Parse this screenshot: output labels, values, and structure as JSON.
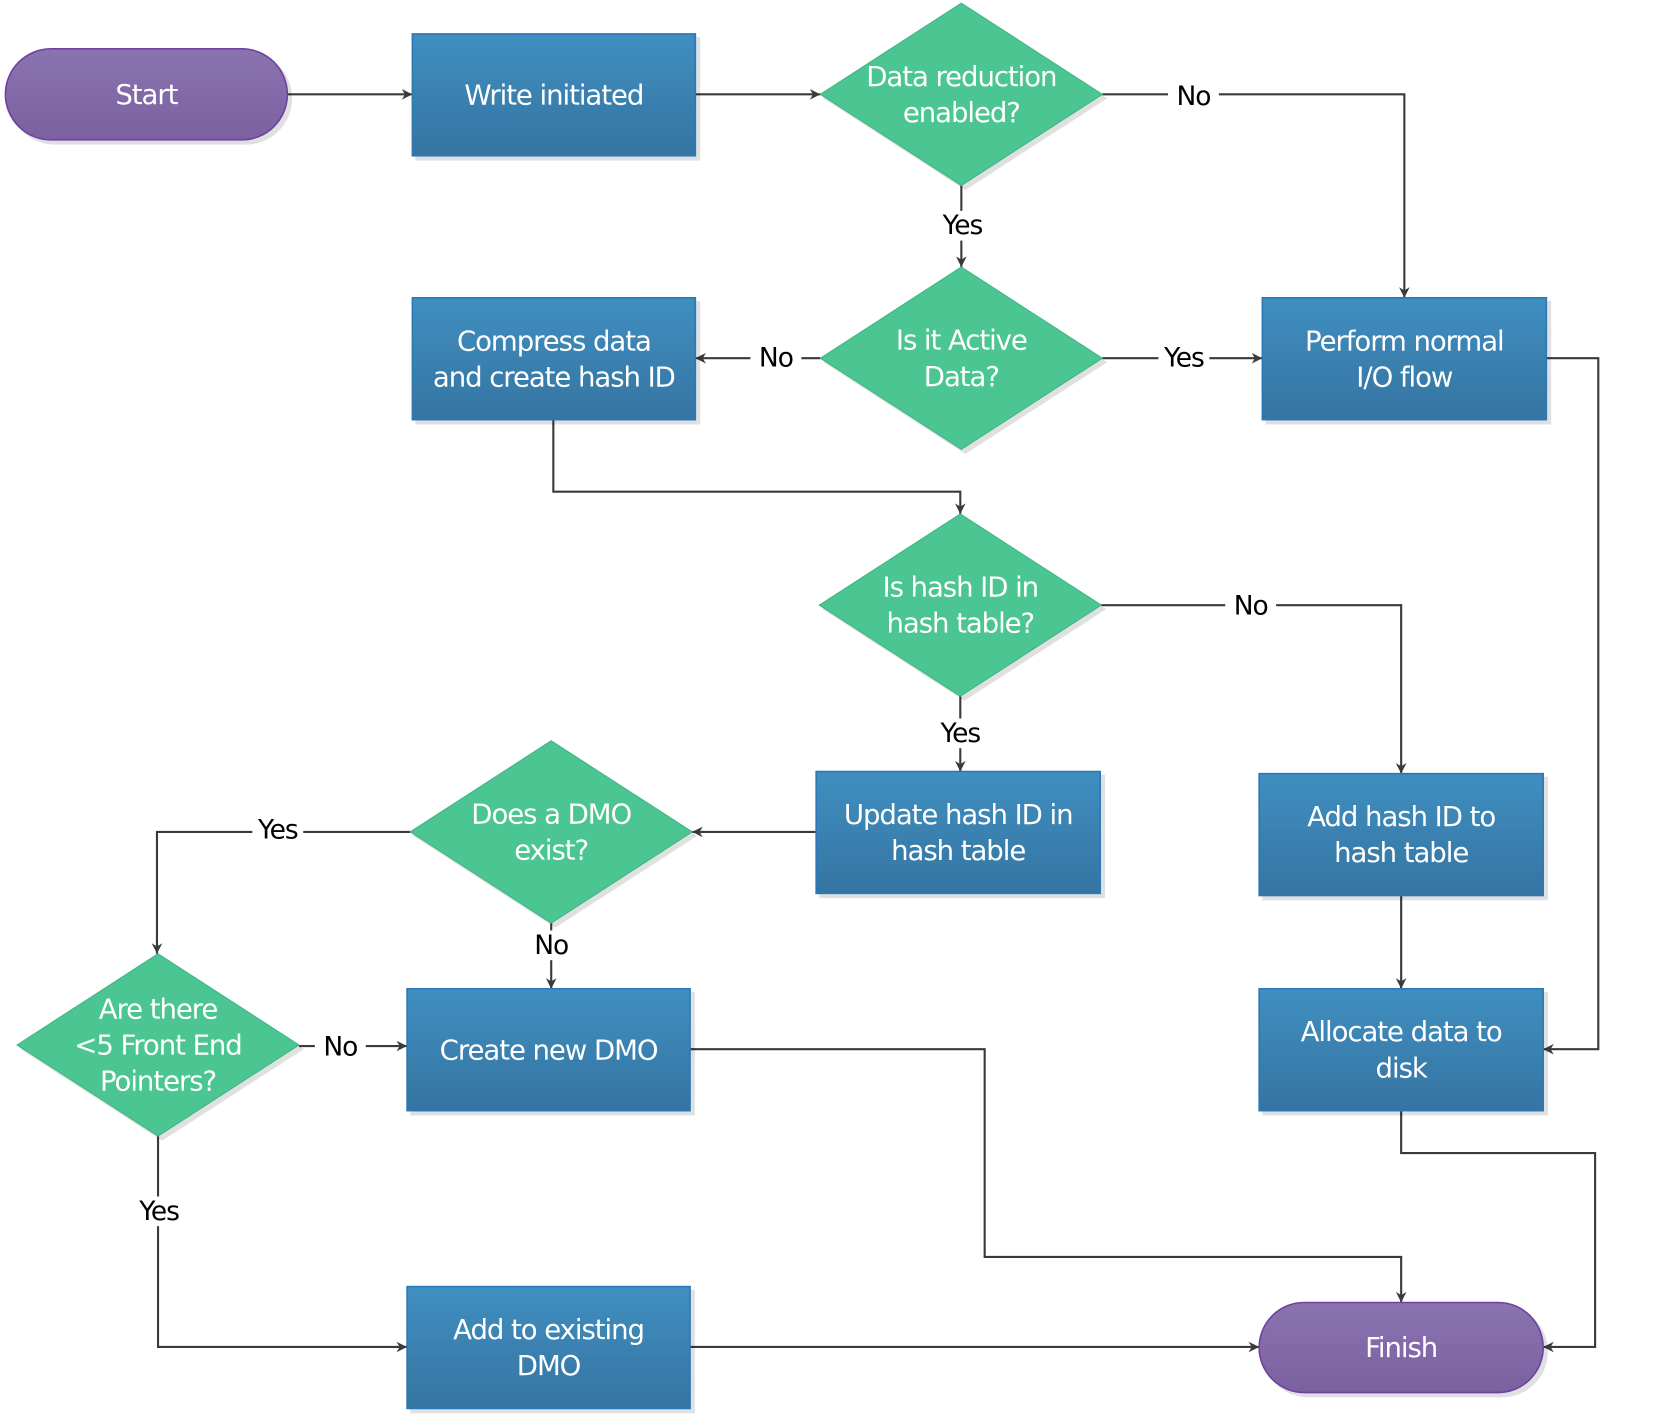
{
  "colors": {
    "process_top": "#3f8fc0",
    "process_bottom": "#3574a2",
    "decision": "#4cc592",
    "terminal_top": "#8a74b0",
    "terminal_bottom": "#7a61a0",
    "connector": "#3a3a3a"
  },
  "nodes": {
    "start": {
      "type": "terminal",
      "lines": [
        "Start"
      ]
    },
    "write": {
      "type": "process",
      "lines": [
        "Write initiated"
      ]
    },
    "d_reduction": {
      "type": "decision",
      "lines": [
        "Data reduction",
        "enabled?"
      ]
    },
    "d_active": {
      "type": "decision",
      "lines": [
        "Is it Active",
        "Data?"
      ]
    },
    "compress": {
      "type": "process",
      "lines": [
        "Compress data",
        "and create hash ID"
      ]
    },
    "normal_io": {
      "type": "process",
      "lines": [
        "Perform normal",
        "I/O flow"
      ]
    },
    "d_hash": {
      "type": "decision",
      "lines": [
        "Is hash ID in",
        "hash table?"
      ]
    },
    "update_hash": {
      "type": "process",
      "lines": [
        "Update hash ID in",
        "hash table"
      ]
    },
    "add_hash": {
      "type": "process",
      "lines": [
        "Add hash ID to",
        "hash table"
      ]
    },
    "d_dmo": {
      "type": "decision",
      "lines": [
        "Does a DMO",
        "exist?"
      ]
    },
    "d_pointers": {
      "type": "decision",
      "lines": [
        "Are there",
        "<5 Front End",
        "Pointers?"
      ]
    },
    "create_dmo": {
      "type": "process",
      "lines": [
        "Create new DMO"
      ]
    },
    "allocate": {
      "type": "process",
      "lines": [
        "Allocate data to",
        "disk"
      ]
    },
    "add_existing": {
      "type": "process",
      "lines": [
        "Add to existing",
        "DMO"
      ]
    },
    "finish": {
      "type": "terminal",
      "lines": [
        "Finish"
      ]
    }
  },
  "edges": [
    {
      "from": "start",
      "to": "write",
      "label": ""
    },
    {
      "from": "write",
      "to": "d_reduction",
      "label": ""
    },
    {
      "from": "d_reduction",
      "to": "normal_io",
      "label": "No"
    },
    {
      "from": "d_reduction",
      "to": "d_active",
      "label": "Yes"
    },
    {
      "from": "d_active",
      "to": "compress",
      "label": "No"
    },
    {
      "from": "d_active",
      "to": "normal_io",
      "label": "Yes"
    },
    {
      "from": "compress",
      "to": "d_hash",
      "label": ""
    },
    {
      "from": "d_hash",
      "to": "add_hash",
      "label": "No"
    },
    {
      "from": "d_hash",
      "to": "update_hash",
      "label": "Yes"
    },
    {
      "from": "update_hash",
      "to": "d_dmo",
      "label": ""
    },
    {
      "from": "d_dmo",
      "to": "d_pointers",
      "label": "Yes"
    },
    {
      "from": "d_dmo",
      "to": "create_dmo",
      "label": "No"
    },
    {
      "from": "d_pointers",
      "to": "create_dmo",
      "label": "No"
    },
    {
      "from": "d_pointers",
      "to": "add_existing",
      "label": "Yes"
    },
    {
      "from": "create_dmo",
      "to": "finish",
      "label": ""
    },
    {
      "from": "add_existing",
      "to": "finish",
      "label": ""
    },
    {
      "from": "normal_io",
      "to": "allocate",
      "label": ""
    },
    {
      "from": "add_hash",
      "to": "allocate",
      "label": ""
    },
    {
      "from": "allocate",
      "to": "finish",
      "label": ""
    }
  ]
}
